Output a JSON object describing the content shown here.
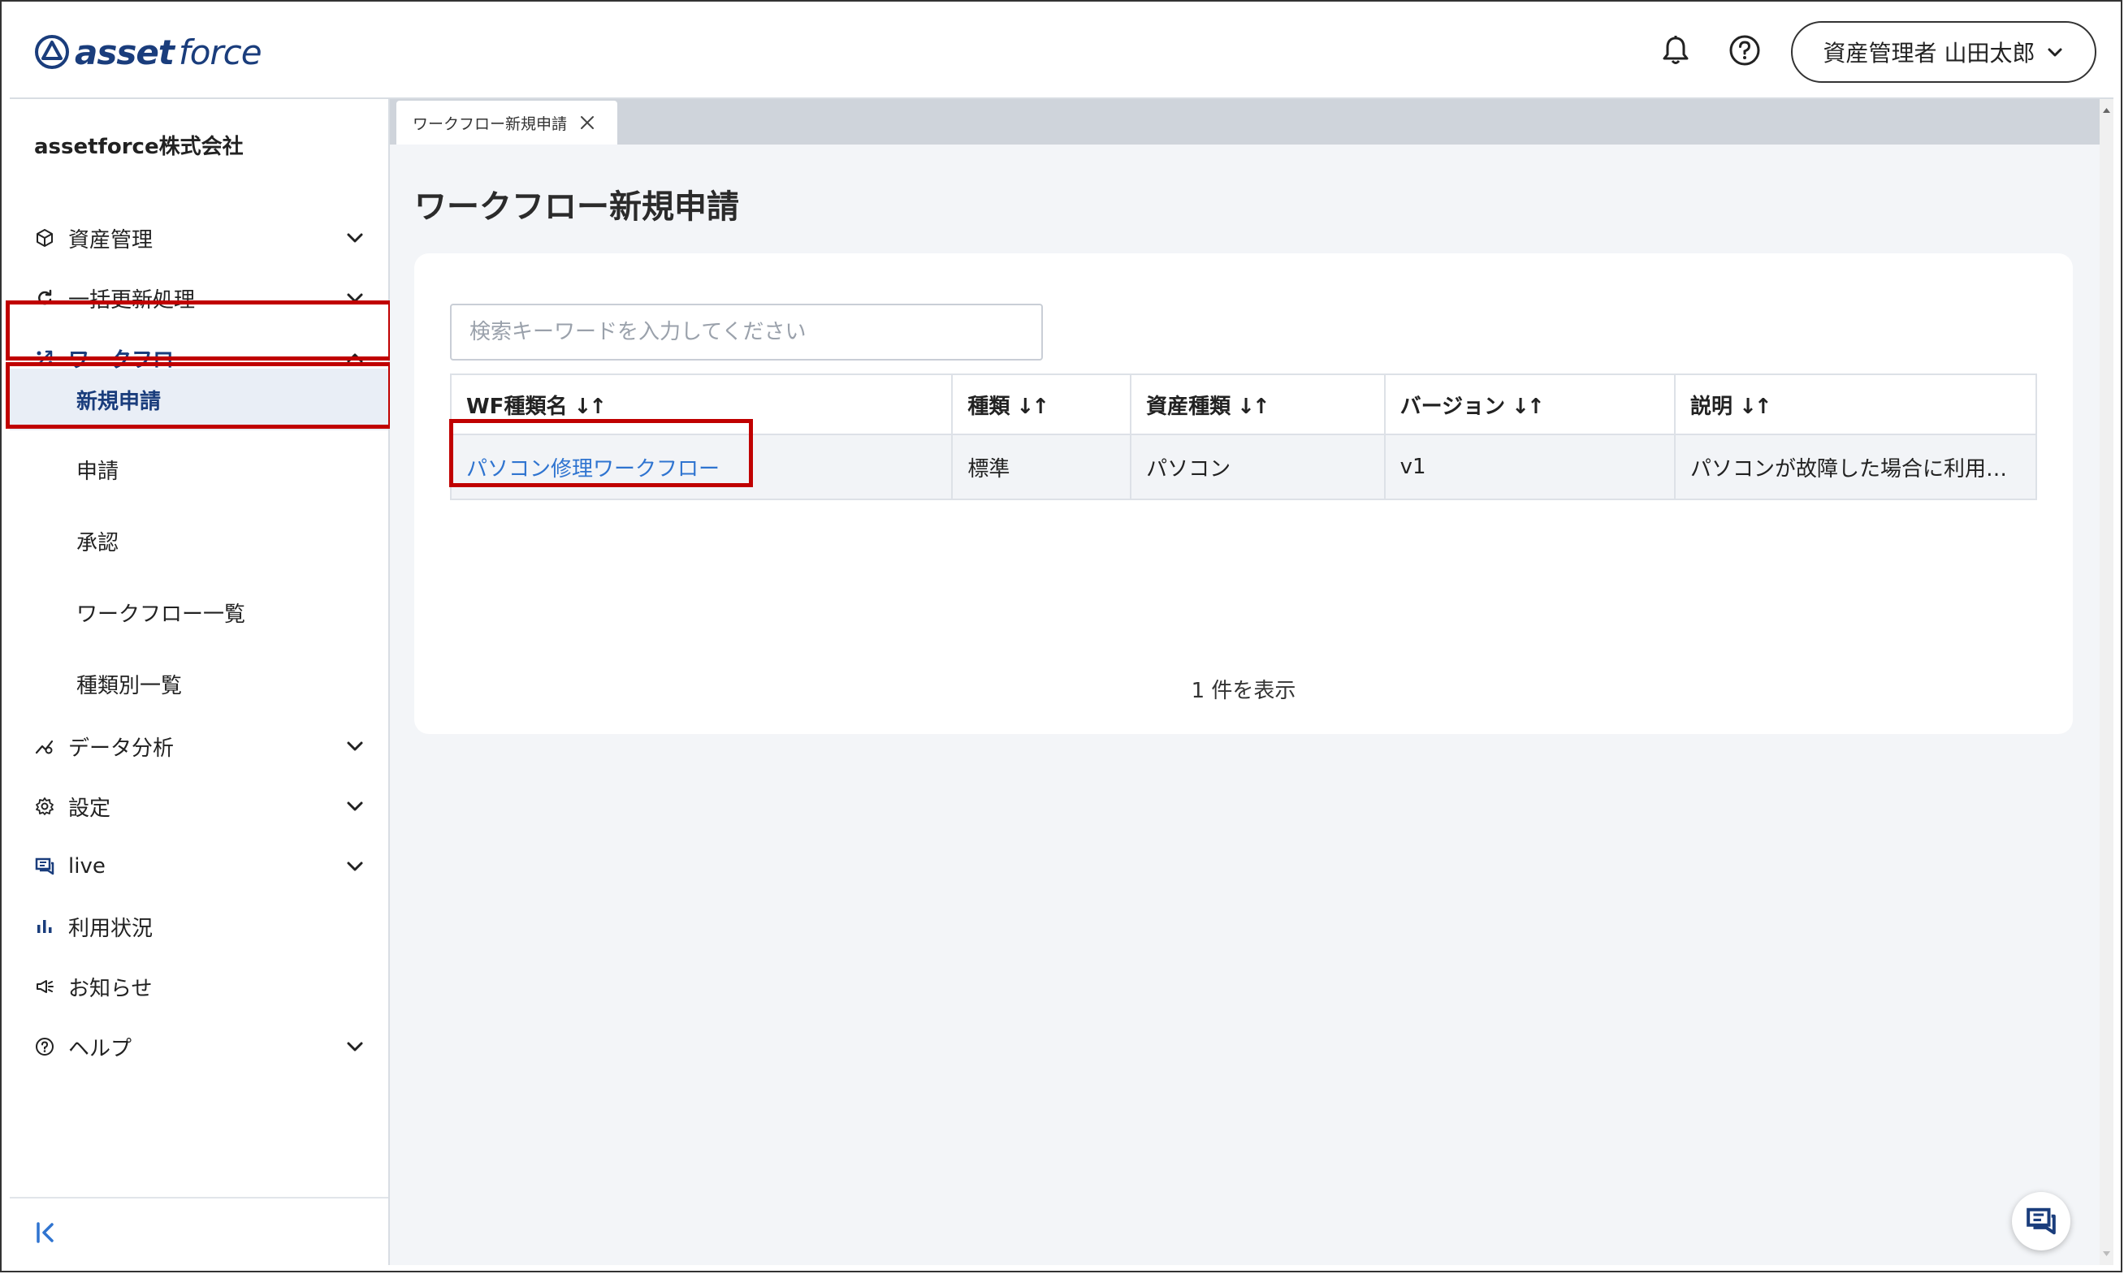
{
  "header": {
    "logo_asset": "asset",
    "logo_force": "force",
    "user_label": "資産管理者 山田太郎",
    "icons": [
      "bell-icon",
      "help-circle-icon",
      "chevron-down-icon"
    ]
  },
  "sidebar": {
    "company": "assetforce株式会社",
    "items": [
      {
        "label": "資産管理",
        "icon": "cube-icon"
      },
      {
        "label": "一括更新処理",
        "icon": "refresh-icon"
      },
      {
        "label": "ワークフロー",
        "icon": "workflow-icon"
      },
      {
        "label": "データ分析",
        "icon": "analytics-icon"
      },
      {
        "label": "設定",
        "icon": "gear-icon"
      },
      {
        "label": "live",
        "icon": "live-chat-icon"
      },
      {
        "label": "利用状況",
        "icon": "bar-chart-icon"
      },
      {
        "label": "お知らせ",
        "icon": "megaphone-icon"
      },
      {
        "label": "ヘルプ",
        "icon": "help-circle-icon"
      }
    ],
    "workflow_sub": [
      "新規申請",
      "申請",
      "承認",
      "ワークフロー一覧",
      "種類別一覧"
    ]
  },
  "main": {
    "tab_label": "ワークフロー新規申請",
    "page_title": "ワークフロー新規申請",
    "search_placeholder": "検索キーワードを入力してください",
    "table": {
      "headers": [
        "WF種類名",
        "種類",
        "資産種類",
        "バージョン",
        "説明"
      ],
      "rows": [
        [
          "パソコン修理ワークフロー",
          "標準",
          "パソコン",
          "v1",
          "パソコンが故障した場合に利用…"
        ]
      ]
    },
    "count_text": "1 件を表示"
  },
  "colors": {
    "brand": "#1a3d7c",
    "link": "#2f74d0",
    "highlight": "#c00000",
    "selected_bg": "#e9eef6"
  }
}
